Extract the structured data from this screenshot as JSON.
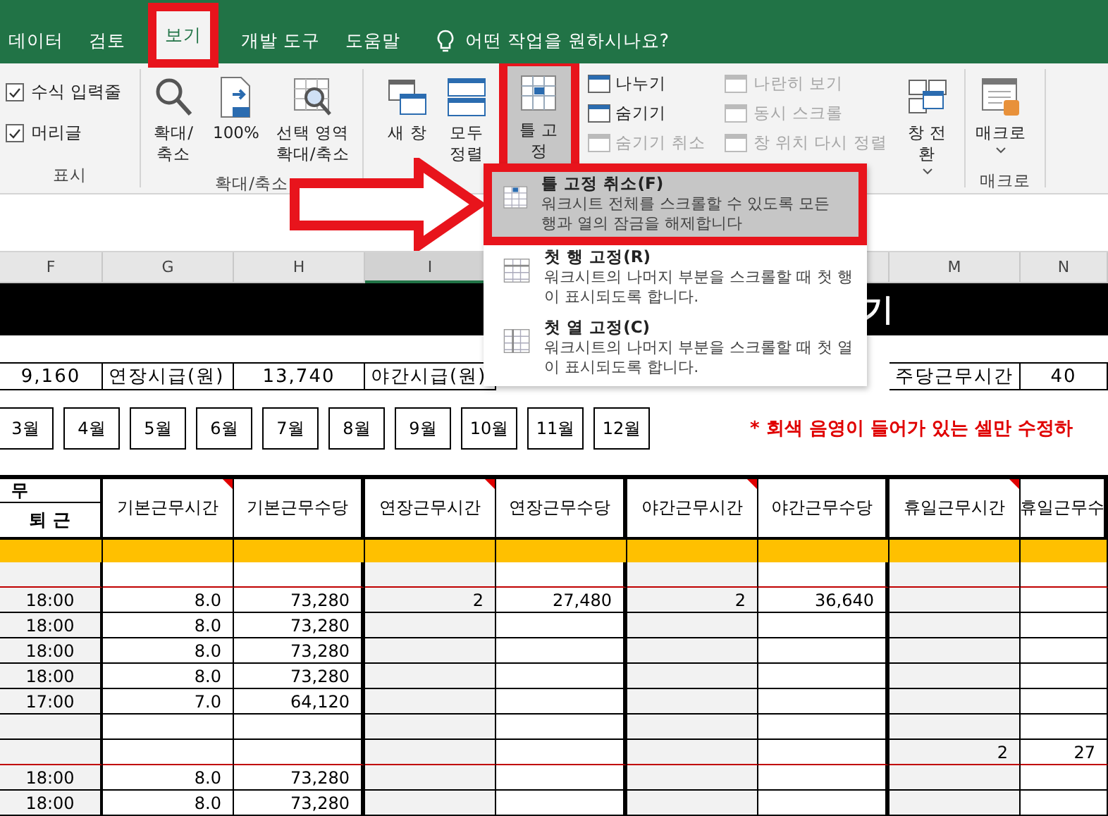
{
  "ribbon_tabs": [
    {
      "label": "데이터",
      "selected": false
    },
    {
      "label": "검토",
      "selected": false
    },
    {
      "label": "보기",
      "selected": true
    },
    {
      "label": "개발 도구",
      "selected": false
    },
    {
      "label": "도움말",
      "selected": false
    }
  ],
  "tell_me": "어떤 작업을 원하시나요?",
  "show_group": {
    "label": "표시",
    "checkboxes": [
      {
        "label": "수식 입력줄",
        "checked": true
      },
      {
        "label": "머리글",
        "checked": true
      }
    ]
  },
  "zoom_group": {
    "label": "확대/축소",
    "buttons": [
      {
        "kind": "zoom",
        "label": "확대/\n축소"
      },
      {
        "kind": "hundred",
        "label": "100%"
      },
      {
        "kind": "selection",
        "label": "선택 영역\n확대/축소"
      }
    ]
  },
  "window_group": {
    "large_buttons": [
      {
        "kind": "new",
        "label": "새 창",
        "selected": false
      },
      {
        "kind": "arrange",
        "label": "모두\n정렬",
        "selected": false
      },
      {
        "kind": "freeze",
        "label": "틀 고정",
        "selected": true
      }
    ],
    "small_buttons": [
      [
        {
          "label": "나누기",
          "disabled": false
        },
        {
          "label": "숨기기",
          "disabled": false
        },
        {
          "label": "숨기기 취소",
          "disabled": true
        }
      ],
      [
        {
          "label": "나란히 보기",
          "disabled": true
        },
        {
          "label": "동시 스크롤",
          "disabled": true
        },
        {
          "label": "창 위치 다시 정렬",
          "disabled": true
        }
      ]
    ],
    "switch_button": "창 전환"
  },
  "macro_group": {
    "button": "매크로",
    "label": "매크로"
  },
  "freeze_menu": [
    {
      "title": "틀 고정 취소(F)",
      "description": "워크시트 전체를 스크롤할 수 있도록 모든 행과 열의 잠금을 해제합니다",
      "selected": true
    },
    {
      "title": "첫 행 고정(R)",
      "description": "워크시트의 나머지 부분을 스크롤할 때 첫 행이 표시되도록 합니다.",
      "selected": false
    },
    {
      "title": "첫 열 고정(C)",
      "description": "워크시트의 나머지 부분을 스크롤할 때 첫 열이 표시되도록 합니다.",
      "selected": false
    }
  ],
  "columns": [
    {
      "label": "F",
      "selected": false
    },
    {
      "label": "G",
      "selected": false
    },
    {
      "label": "H",
      "selected": false
    },
    {
      "label": "I",
      "selected": true
    }
  ],
  "right_columns": [
    {
      "label": "M",
      "selected": false
    },
    {
      "label": "N",
      "selected": false
    }
  ],
  "banner": "기",
  "rates": [
    "9,160",
    "연장시급(원)",
    "13,740",
    "야간시급(원)"
  ],
  "weekly_hours": {
    "label": "주당근무시간",
    "value": "40"
  },
  "months": [
    "3월",
    "4월",
    "5월",
    "6월",
    "7월",
    "8월",
    "9월",
    "10월",
    "11월",
    "12월"
  ],
  "note": "* 회색 음영이 들어가 있는 셀만 수정하",
  "table": {
    "first_header": [
      "무",
      "퇴 근"
    ],
    "headers": [
      {
        "label": "기본근무시간",
        "comment": true
      },
      {
        "label": "기본근무수당",
        "comment": false
      },
      {
        "label": "연장근무시간",
        "comment": true
      },
      {
        "label": "연장근무수당",
        "comment": false
      },
      {
        "label": "야간근무시간",
        "comment": true
      },
      {
        "label": "야간근무수당",
        "comment": false
      },
      {
        "label": "휴일근무시간",
        "comment": true
      },
      {
        "label": "휴일근무수",
        "comment": false
      }
    ],
    "rows": [
      {
        "week_end": true,
        "cells": [
          "",
          "",
          "",
          "",
          "",
          "",
          "",
          "",
          ""
        ]
      },
      {
        "week_end": false,
        "cells": [
          "18:00",
          "8.0",
          "73,280",
          "2",
          "27,480",
          "2",
          "36,640",
          "",
          ""
        ]
      },
      {
        "week_end": false,
        "cells": [
          "18:00",
          "8.0",
          "73,280",
          "",
          "",
          "",
          "",
          "",
          ""
        ]
      },
      {
        "week_end": false,
        "cells": [
          "18:00",
          "8.0",
          "73,280",
          "",
          "",
          "",
          "",
          "",
          ""
        ]
      },
      {
        "week_end": false,
        "cells": [
          "18:00",
          "8.0",
          "73,280",
          "",
          "",
          "",
          "",
          "",
          ""
        ]
      },
      {
        "week_end": false,
        "cells": [
          "17:00",
          "7.0",
          "64,120",
          "",
          "",
          "",
          "",
          "",
          ""
        ]
      },
      {
        "week_end": false,
        "cells": [
          "",
          "",
          "",
          "",
          "",
          "",
          "",
          "",
          ""
        ]
      },
      {
        "week_end": true,
        "cells": [
          "",
          "",
          "",
          "",
          "",
          "",
          "",
          "2",
          "27"
        ]
      },
      {
        "week_end": false,
        "cells": [
          "18:00",
          "8.0",
          "73,280",
          "",
          "",
          "",
          "",
          "",
          ""
        ]
      },
      {
        "week_end": false,
        "cells": [
          "18:00",
          "8.0",
          "73,280",
          "",
          "",
          "",
          "",
          "",
          ""
        ]
      }
    ]
  }
}
